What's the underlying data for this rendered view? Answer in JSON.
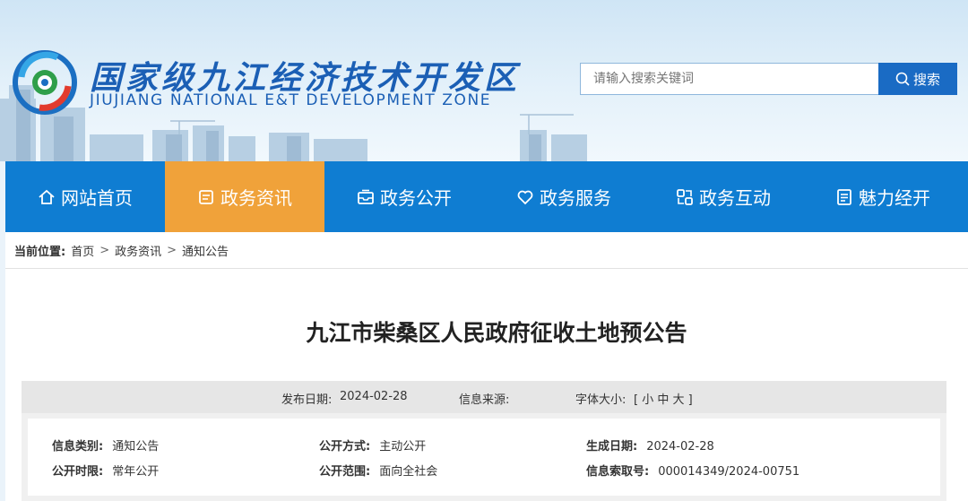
{
  "site": {
    "name_cn": "国家级九江经济技术开发区",
    "name_en": "JIUJIANG NATIONAL E&T DEVELOPMENT ZONE",
    "logo_icon": "jiujiang-emblem-icon"
  },
  "search": {
    "placeholder": "请输入搜索关键词",
    "button_label": "搜索",
    "button_icon": "search-icon"
  },
  "nav": {
    "active_color": "#f0a23a",
    "bar_color": "#0f7dd2",
    "items": [
      {
        "label": "网站首页",
        "icon": "home-icon"
      },
      {
        "label": "政务资讯",
        "icon": "news-icon",
        "active": true
      },
      {
        "label": "政务公开",
        "icon": "inbox-icon"
      },
      {
        "label": "政务服务",
        "icon": "heart-icon"
      },
      {
        "label": "政务互动",
        "icon": "link-icon"
      },
      {
        "label": "魅力经开",
        "icon": "document-icon"
      }
    ]
  },
  "breadcrumb": {
    "prefix": "当前位置:",
    "items": [
      "首页",
      "政务资讯",
      "通知公告"
    ],
    "separator": ">"
  },
  "article": {
    "title": "九江市柴桑区人民政府征收土地预公告",
    "publish_date_label": "发布日期:",
    "publish_date": "2024-02-28",
    "source_label": "信息来源:",
    "source": "",
    "font_size_label": "字体大小:",
    "font_size_options": "[ 小 中 大 ]"
  },
  "info": {
    "category_label": "信息类别:",
    "category": "通知公告",
    "method_label": "公开方式:",
    "method": "主动公开",
    "created_label": "生成日期:",
    "created": "2024-02-28",
    "period_label": "公开时限:",
    "period": "常年公开",
    "scope_label": "公开范围:",
    "scope": "面向全社会",
    "index_label": "信息索取号:",
    "index": "000014349/2024-00751"
  }
}
